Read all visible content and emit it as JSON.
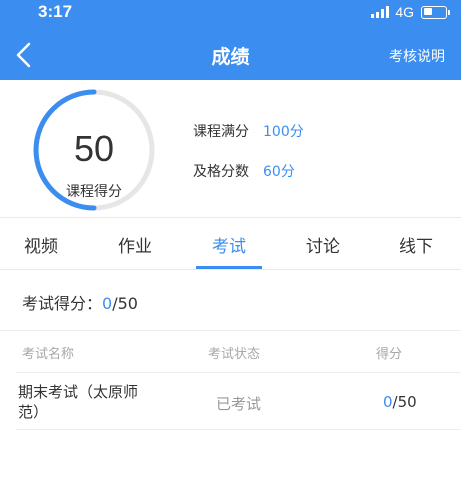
{
  "status_bar": {
    "time": "3:17",
    "network": "4G"
  },
  "header": {
    "title": "成绩",
    "help_link": "考核说明"
  },
  "score": {
    "value": "50",
    "label": "课程得分",
    "progress": 0.5,
    "max_label": "课程满分",
    "max_value": "100分",
    "pass_label": "及格分数",
    "pass_value": "60分"
  },
  "tabs": [
    {
      "label": "视频",
      "active": false
    },
    {
      "label": "作业",
      "active": false
    },
    {
      "label": "考试",
      "active": true
    },
    {
      "label": "讨论",
      "active": false
    },
    {
      "label": "线下",
      "active": false
    }
  ],
  "exam_summary": {
    "label": "考试得分：",
    "got": "0",
    "total": "/50"
  },
  "table": {
    "headers": [
      "考试名称",
      "考试状态",
      "得分"
    ],
    "rows": [
      {
        "name": "期末考试（太原师范）",
        "status": "已考试",
        "got": "0",
        "total": "/50"
      }
    ]
  },
  "colors": {
    "accent": "#3b8ef0",
    "ring_track": "#e6e6e6",
    "muted": "#a8a8a8"
  }
}
